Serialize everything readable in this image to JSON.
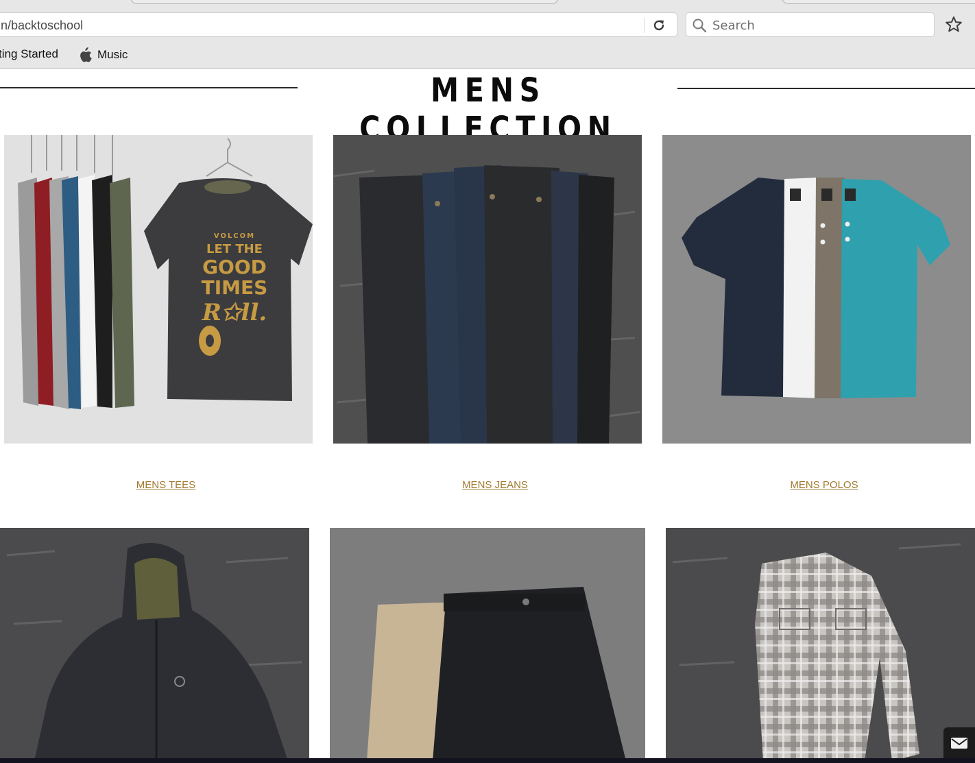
{
  "browser": {
    "url": "n/backtoschool",
    "search_placeholder": "Search",
    "bookmarks": [
      {
        "label": "ting Started"
      },
      {
        "label": "Music",
        "icon": "apple-icon"
      }
    ]
  },
  "page": {
    "heading": "MENS COLLECTION",
    "accent_color": "#a07a2e"
  },
  "categories": [
    {
      "label": "MENS TEES",
      "image": "tees-photo"
    },
    {
      "label": "MENS JEANS",
      "image": "jeans-photo"
    },
    {
      "label": "MENS POLOS",
      "image": "polos-photo"
    }
  ],
  "second_row_images": [
    "jacket-photo",
    "shorts-photo",
    "flannel-photo"
  ],
  "widgets": {
    "mail_icon": "envelope-icon"
  }
}
